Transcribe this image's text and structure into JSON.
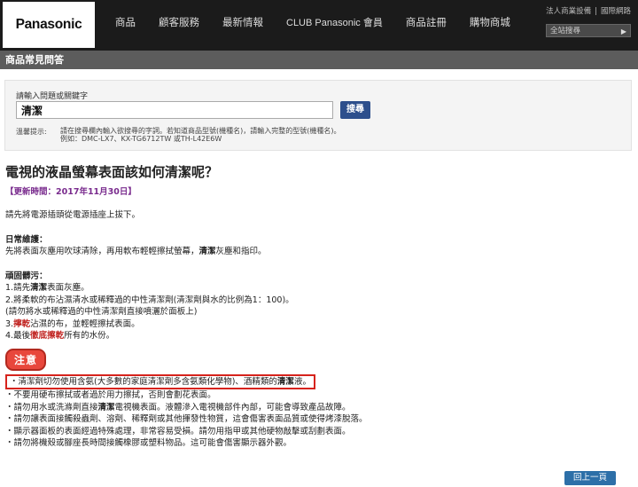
{
  "header": {
    "logo": "Panasonic",
    "nav": [
      "商品",
      "顧客服務",
      "最新情報",
      "CLUB Panasonic 會員",
      "商品註冊",
      "購物商城"
    ],
    "top_links": [
      "法人商業設備",
      "|",
      "國際網路"
    ],
    "site_search_placeholder": "全站搜尋"
  },
  "section_title": "商品常見問答",
  "search": {
    "label": "請輸入問題或關鍵字",
    "value": "清潔",
    "button": "搜尋",
    "hint_label": "溫馨提示:",
    "hint_line1": "請在搜尋欄內輸入欲搜尋的字詞。若知道商品型號(機種名)，請輸入完整的型號(機種名)。",
    "hint_line2": "例如：DMC-LX7、KX-TG6712TW 或TH-L42E6W"
  },
  "article": {
    "title": "電視的液晶螢幕表面該如何清潔呢？",
    "updated": "【更新時間：2017年11月30日】",
    "intro": "請先將電源插頭從電源插座上拔下。",
    "daily_heading": "日常維護：",
    "daily_pre": "先將表面灰塵用吹球清除，再用軟布輕輕擦拭螢幕，",
    "daily_bold": "清潔",
    "daily_post": "灰塵和指印。",
    "stubborn_heading": "頑固髒污：",
    "step1_pre": "1.請先",
    "step1_bold": "清潔",
    "step1_post": "表面灰塵。",
    "step2": "2.將柔軟的布沾濕清水或稀釋過的中性清潔劑(清潔劑與水的比例為1：100)。",
    "step2_note": "(請勿將水或稀釋過的中性清潔劑直接噴灑於面板上)",
    "step3_pre": "3.",
    "step3_red": "擰乾",
    "step3_post": "沾濕的布，並輕輕擦拭表面。",
    "step4_pre": "4.最後",
    "step4_red": "徹底擦乾",
    "step4_post": "所有的水份。",
    "notice_badge": "注意",
    "notice_highlight_pre": "・清潔劑切勿使用含氨(大多數的家庭清潔劑多含氨類化學物)、酒精類的",
    "notice_highlight_bold": "清潔",
    "notice_highlight_post": "液。",
    "notice_line2": "・不要用硬布擦拭或者過於用力擦拭，否則會劃花表面。",
    "notice_line3_pre": "・請勿用水或洗滌劑直接",
    "notice_line3_bold": "清潔",
    "notice_line3_post": "電視機表面。液體滲入電視機部件內部，可能會導致產品故障。",
    "notice_line4": "・請勿讓表面接觸殺蟲劑、溶劑、稀釋劑或其他揮發性物質，這會傷害表面品質或使得烤漆脫落。",
    "notice_line5": "・顯示器面板的表面經過特殊處理，非常容易受損。請勿用指甲或其他硬物敲擊或刮劃表面。",
    "notice_line6": "・請勿將機殼或腳座長時間接觸橡膠或塑料物品。這可能會傷害顯示器外觀。"
  },
  "back_button": "回上一頁"
}
